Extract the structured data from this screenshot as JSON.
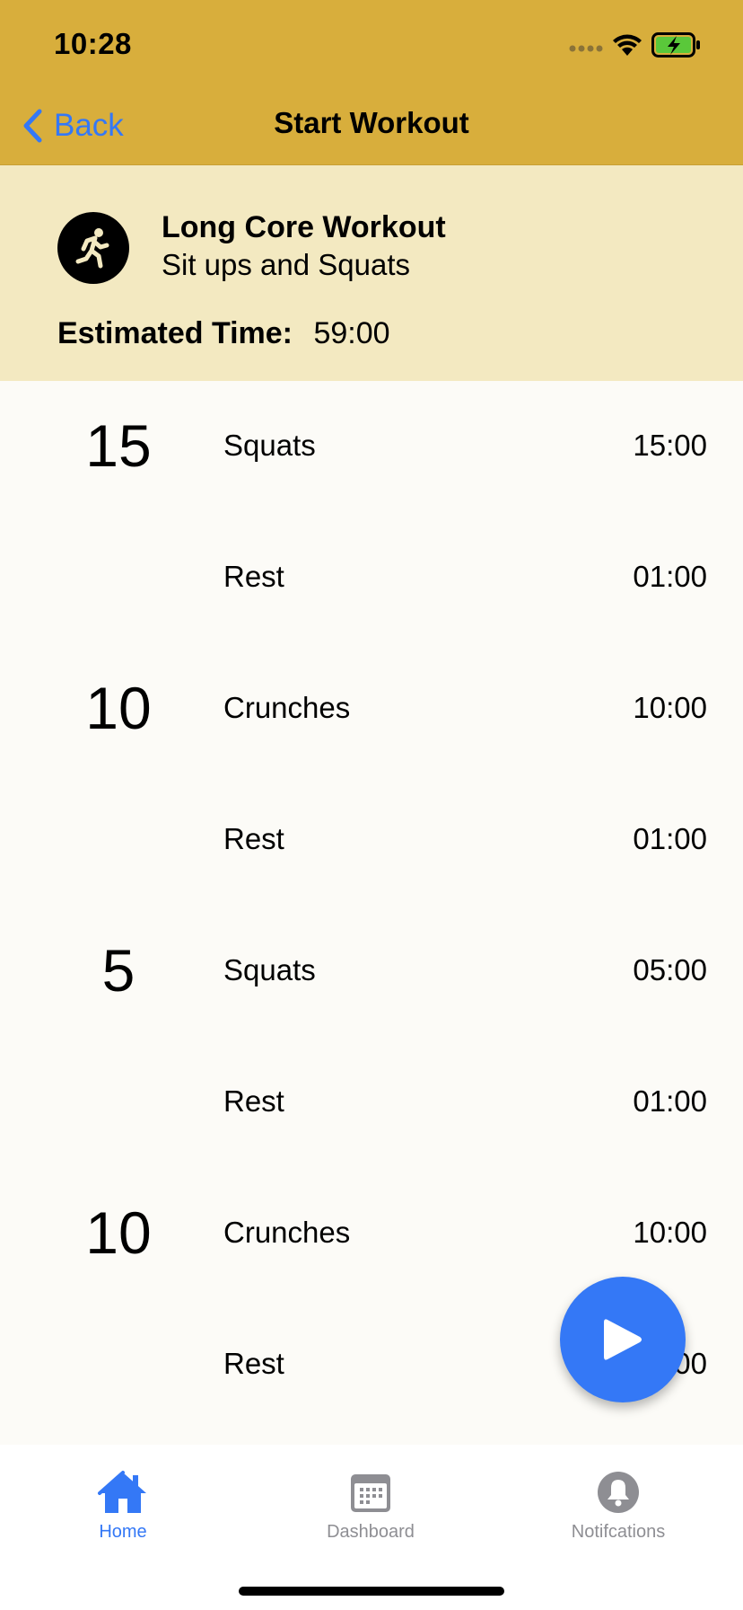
{
  "status_bar": {
    "time": "10:28",
    "signal_icon": "cellular-dots-icon",
    "wifi_icon": "wifi-icon",
    "battery_icon": "battery-charging-icon",
    "battery_color": "#5ac83a"
  },
  "nav": {
    "back_label": "Back",
    "title": "Start Workout"
  },
  "workout": {
    "icon": "running-person-icon",
    "name": "Long Core Workout",
    "subtitle": "Sit ups and Squats",
    "estimated_label": "Estimated Time:",
    "estimated_value": "59:00"
  },
  "exercises": [
    {
      "reps": "15",
      "name": "Squats",
      "time": "15:00"
    },
    {
      "reps": "",
      "name": "Rest",
      "time": "01:00"
    },
    {
      "reps": "10",
      "name": "Crunches",
      "time": "10:00"
    },
    {
      "reps": "",
      "name": "Rest",
      "time": "01:00"
    },
    {
      "reps": "5",
      "name": "Squats",
      "time": "05:00"
    },
    {
      "reps": "",
      "name": "Rest",
      "time": "01:00"
    },
    {
      "reps": "10",
      "name": "Crunches",
      "time": "10:00"
    },
    {
      "reps": "",
      "name": "Rest",
      "time": "01:00"
    }
  ],
  "play_button": {
    "icon": "play-icon"
  },
  "tabs": [
    {
      "label": "Home",
      "icon": "home-icon",
      "active": true
    },
    {
      "label": "Dashboard",
      "icon": "calendar-icon",
      "active": false
    },
    {
      "label": "Notifcations",
      "icon": "bell-icon",
      "active": false
    }
  ],
  "colors": {
    "nav_bar": "#d8ae3c",
    "header_bg": "#f3e9c1",
    "accent": "#3478f6",
    "inactive_tab": "#8e8e93"
  }
}
